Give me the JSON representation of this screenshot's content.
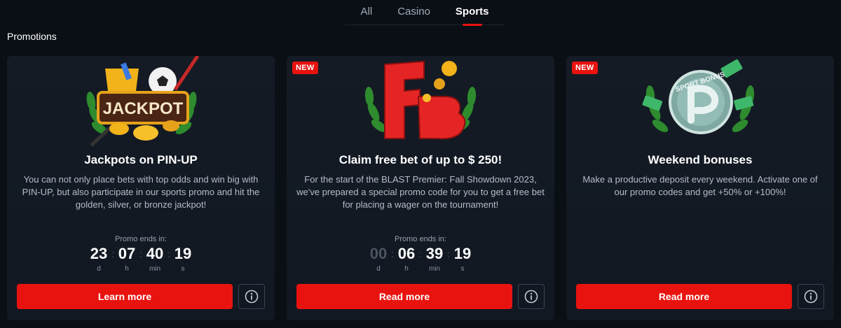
{
  "tabs": [
    {
      "label": "All"
    },
    {
      "label": "Casino"
    },
    {
      "label": "Sports"
    }
  ],
  "section_title": "Promotions",
  "cards": [
    {
      "badge": "",
      "art_text": "JACKPOT",
      "title": "Jackpots on PIN-UP",
      "description": "You can not only place bets with top odds and win big with PIN-UP, but also participate in our sports promo and hit the golden, silver, or bronze jackpot!",
      "countdown": {
        "label": "Promo ends in:",
        "units": [
          {
            "value": "23",
            "unit": "d"
          },
          {
            "value": "07",
            "unit": "h"
          },
          {
            "value": "40",
            "unit": "min"
          },
          {
            "value": "19",
            "unit": "s"
          }
        ]
      },
      "button": "Learn more"
    },
    {
      "badge": "NEW",
      "title": "Claim free bet of up to $ 250!",
      "description": "For the start of the BLAST Premier: Fall Showdown 2023, we've prepared a special promo code for you to get a free bet for placing a wager on the tournament!",
      "countdown": {
        "label": "Promo ends in:",
        "units": [
          {
            "value": "00",
            "unit": "d"
          },
          {
            "value": "06",
            "unit": "h"
          },
          {
            "value": "39",
            "unit": "min"
          },
          {
            "value": "19",
            "unit": "s"
          }
        ]
      },
      "button": "Read more"
    },
    {
      "badge": "NEW",
      "art_text": "SPORT BONUS",
      "title": "Weekend bonuses",
      "description": "Make a productive deposit every weekend. Activate one of our promo codes and get +50% or +100%!",
      "button": "Read more"
    }
  ],
  "colors": {
    "accent": "#e8130f",
    "background": "#0a0f16",
    "card": "#141b25"
  }
}
